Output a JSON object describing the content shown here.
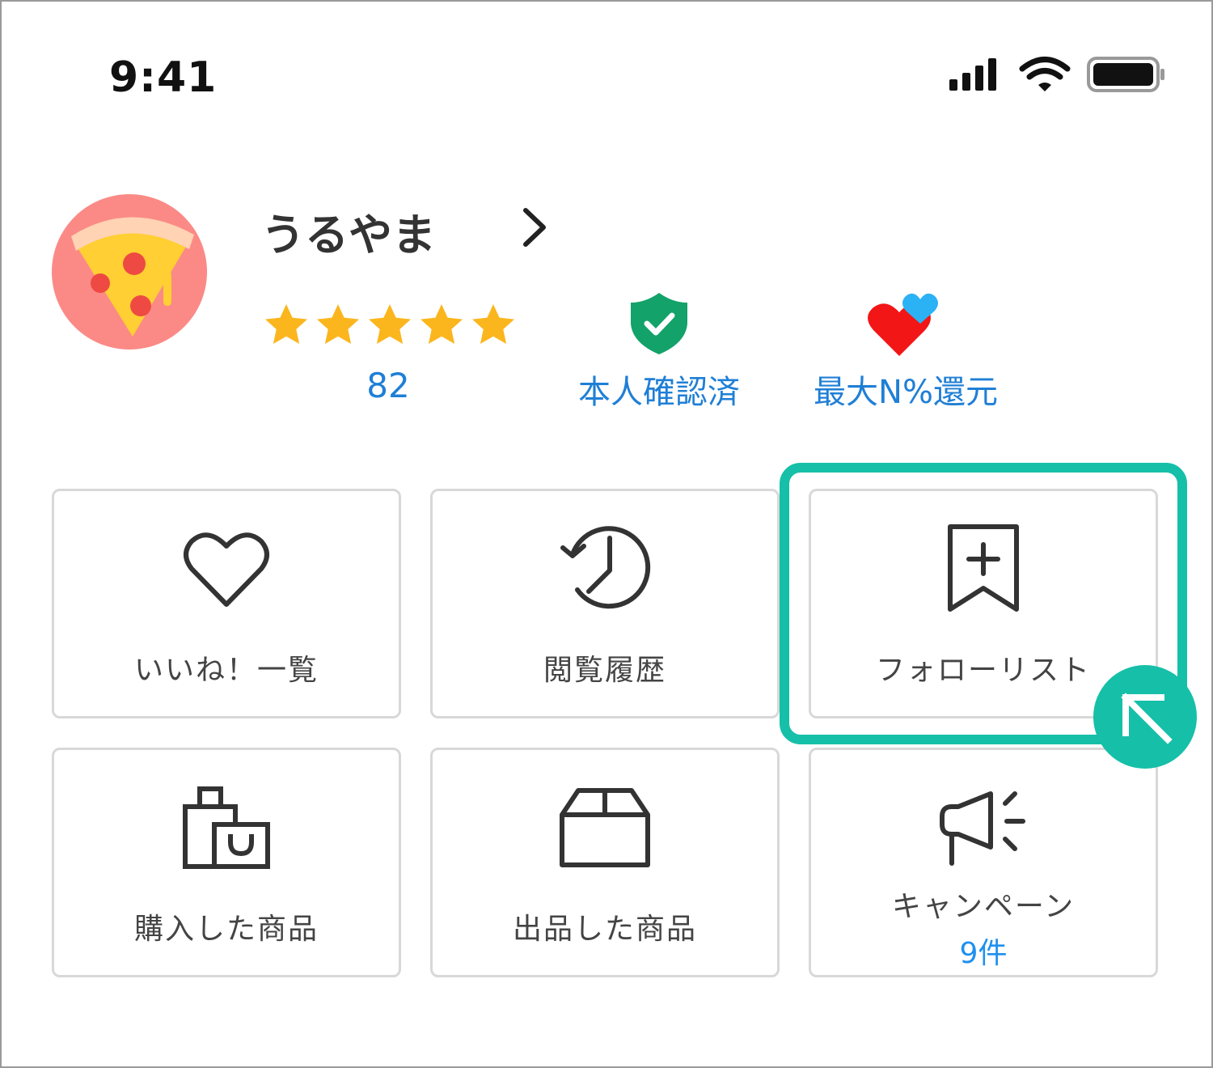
{
  "status_bar": {
    "time": "9:41"
  },
  "profile": {
    "name": "うるやま",
    "rating_count": "82",
    "verified_label": "本人確認済",
    "return_label": "最大N%還元"
  },
  "menu": {
    "likes_label": "いいね！一覧",
    "history_label": "閲覧履歴",
    "follow_label": "フォローリスト",
    "purchased_label": "購入した商品",
    "listed_label": "出品した商品",
    "campaign_label": "キャンペーン",
    "campaign_count": "9件"
  },
  "colors": {
    "accent_teal": "#16bfa8",
    "link_blue": "#1f7fd6",
    "star_yellow": "#fbb61e",
    "shield_green": "#12a26a",
    "heart_red": "#f21616",
    "heart_blue": "#2bb2f5",
    "avatar_bg": "#fb8a86"
  },
  "icons": {
    "likes": "heart-icon",
    "history": "history-clock-icon",
    "follow": "bookmark-plus-icon",
    "purchased": "shopping-bags-icon",
    "listed": "box-icon",
    "campaign": "megaphone-icon"
  }
}
